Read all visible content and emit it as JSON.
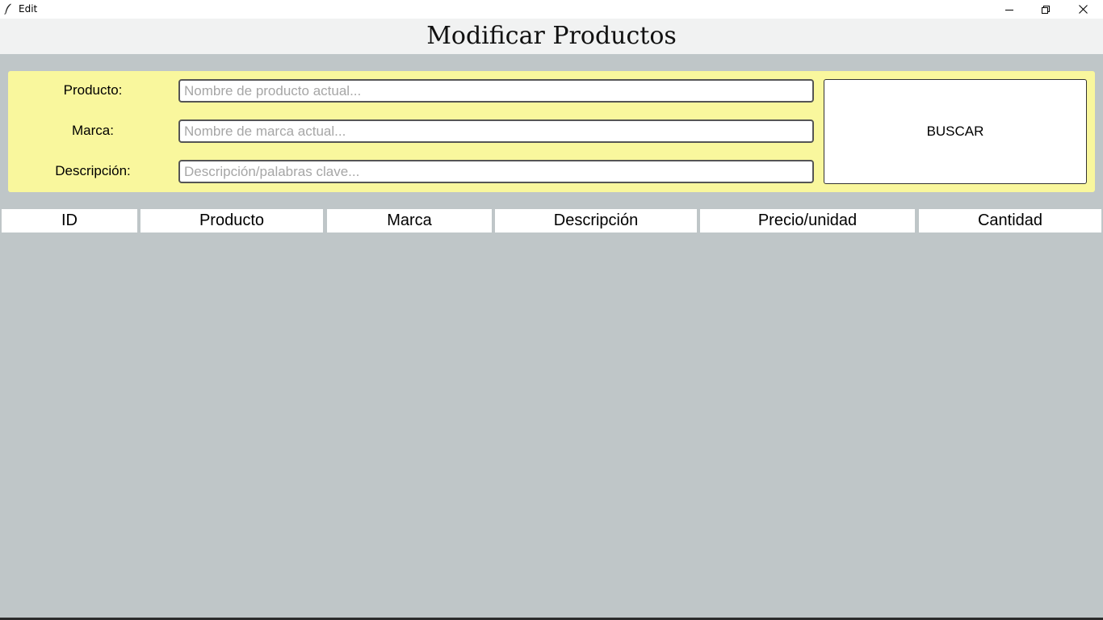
{
  "window": {
    "title": "Edit",
    "icons": {
      "app": "feather-icon",
      "minimize": "minimize-icon",
      "maximize": "restore-icon",
      "close": "close-icon"
    }
  },
  "header": {
    "title": "Modificar Productos"
  },
  "search": {
    "fields": [
      {
        "label": "Producto:",
        "value": "",
        "placeholder": "Nombre de producto actual..."
      },
      {
        "label": "Marca:",
        "value": "",
        "placeholder": "Nombre de marca actual..."
      },
      {
        "label": "Descripción:",
        "value": "",
        "placeholder": "Descripción/palabras clave..."
      }
    ],
    "button_label": "BUSCAR"
  },
  "table": {
    "columns": [
      "ID",
      "Producto",
      "Marca",
      "Descripción",
      "Precio/unidad",
      "Cantidad"
    ],
    "rows": []
  },
  "colors": {
    "background": "#bfc6c8",
    "panel": "#f9f79d",
    "header_bar": "#f1f2f2"
  }
}
